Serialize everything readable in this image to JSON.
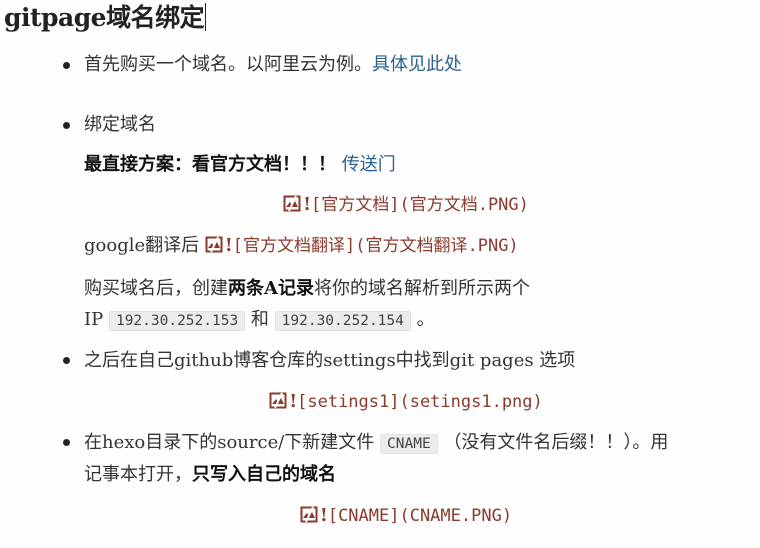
{
  "title": "gitpage域名绑定",
  "item1": {
    "text": "首先购买一个域名。以阿里云为例。",
    "link": "具体见此处"
  },
  "item2": {
    "text": "绑定域名",
    "bold": "最直接方案：看官方文档！！！",
    "link": "传送门",
    "img1_alt": "[官方文档](官方文档.PNG)",
    "google_prefix": "google翻译后",
    "img2_alt": "[官方文档翻译](官方文档翻译.PNG)",
    "para_a": "购买域名后，创建",
    "para_bold": "两条A记录",
    "para_b": "将你的域名解析到所示两个",
    "ip_prefix": "IP",
    "ip1": "192.30.252.153",
    "and": "和",
    "ip2": "192.30.252.154",
    "end": "。"
  },
  "item3": {
    "text": "之后在自己github博客仓库的settings中找到git pages 选项",
    "img_alt": "[setings1](setings1.png)"
  },
  "item4": {
    "text_a": "在hexo目录下的source/下新建文件",
    "code": "CNAME",
    "text_b": "（没有文件名后缀！！）。用",
    "text_c": "记事本打开，",
    "bold": "只写入自己的域名",
    "img_alt": "[CNAME](CNAME.PNG)"
  },
  "icons": {
    "broken_image": "broken-image-icon"
  },
  "colors": {
    "link": "#2a5f8f",
    "markdown_image": "#8b3a2e"
  }
}
